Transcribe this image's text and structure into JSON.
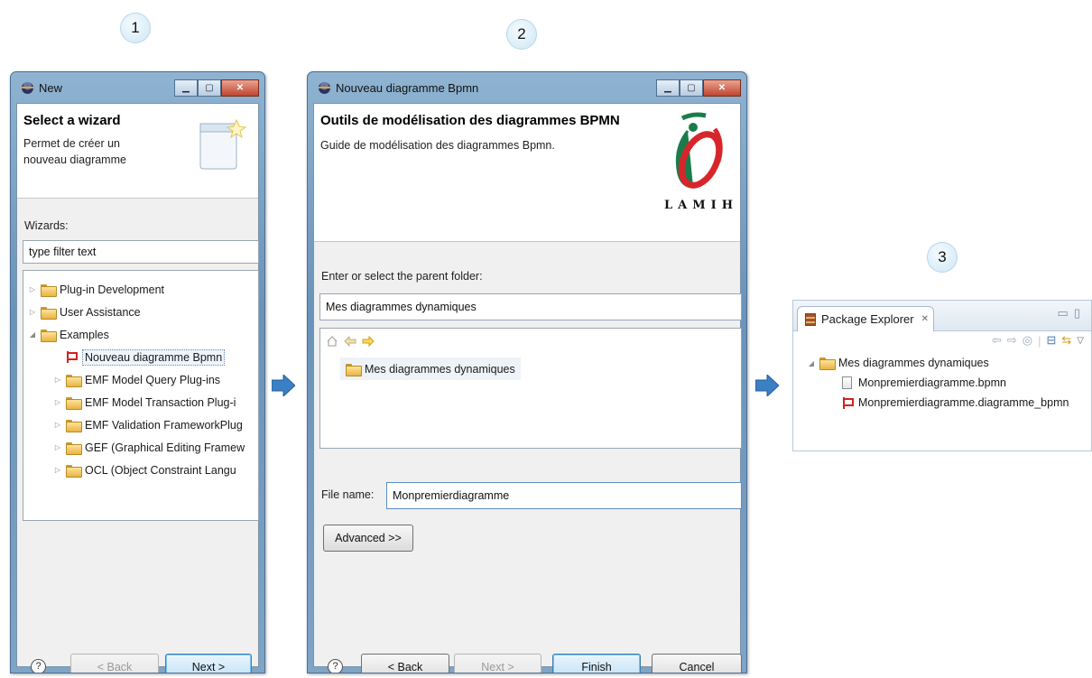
{
  "steps": [
    "1",
    "2",
    "3"
  ],
  "wizard": {
    "title": "New",
    "header_title": "Select a wizard",
    "header_desc_line1": "Permet de créer un",
    "header_desc_line2": "nouveau diagramme",
    "wizards_label": "Wizards:",
    "filter_text": "type filter text",
    "tree": [
      {
        "label": "Plug-in Development",
        "type": "folder",
        "expander": "closed",
        "level": 0
      },
      {
        "label": "User Assistance",
        "type": "folder",
        "expander": "closed",
        "level": 0
      },
      {
        "label": "Examples",
        "type": "folder",
        "expander": "open",
        "level": 0
      },
      {
        "label": "Nouveau diagramme Bpmn",
        "type": "flag",
        "expander": "none",
        "level": 1,
        "selected": true
      },
      {
        "label": "EMF Model Query Plug-ins",
        "type": "folder",
        "expander": "closed",
        "level": 1
      },
      {
        "label": "EMF Model Transaction Plug-i",
        "type": "folder",
        "expander": "closed",
        "level": 1
      },
      {
        "label": "EMF Validation FrameworkPlug",
        "type": "folder",
        "expander": "closed",
        "level": 1
      },
      {
        "label": "GEF (Graphical Editing Framew",
        "type": "folder",
        "expander": "closed",
        "level": 1
      },
      {
        "label": "OCL (Object Constraint Langu",
        "type": "folder",
        "expander": "closed",
        "level": 1
      }
    ],
    "help": "?",
    "back_label": "< Back",
    "next_label": "Next >"
  },
  "bpmn": {
    "title": "Nouveau diagramme Bpmn",
    "header_title": "Outils de modélisation des diagrammes BPMN",
    "header_desc": "Guide de modélisation des diagrammes Bpmn.",
    "logo_text": "LAMIH",
    "parent_label": "Enter or select the parent folder:",
    "parent_value": "Mes diagrammes dynamiques",
    "tree_item": "Mes diagrammes dynamiques",
    "file_label": "File name:",
    "file_value": "Monpremierdiagramme",
    "advanced_label": "Advanced >>",
    "help": "?",
    "back_label": "< Back",
    "next_label": "Next >",
    "finish_label": "Finish",
    "cancel_label": "Cancel"
  },
  "explorer": {
    "tab_label": "Package Explorer",
    "tab_close": "✕",
    "tree": [
      {
        "label": "Mes diagrammes dynamiques",
        "type": "folder"
      },
      {
        "label": "Monpremierdiagramme.bpmn",
        "type": "file"
      },
      {
        "label": "Monpremierdiagramme.diagramme_bpmn",
        "type": "flag"
      }
    ]
  },
  "colors": {
    "arrow": "#3b7fc4",
    "logo_red": "#d7262b",
    "logo_green": "#1a7c4a"
  }
}
